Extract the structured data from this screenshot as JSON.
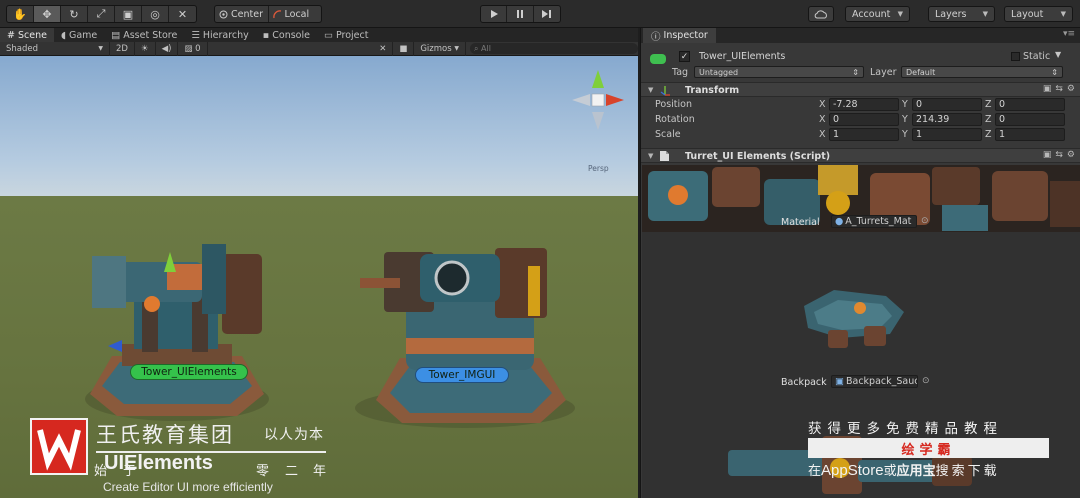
{
  "toolbar": {
    "transform_tools": [
      {
        "name": "hand-tool",
        "icon": "hand-icon",
        "glyph": "✋"
      },
      {
        "name": "move-tool",
        "icon": "move-arrows-icon",
        "glyph": "✥"
      },
      {
        "name": "rotate-tool",
        "icon": "rotate-icon",
        "glyph": "↻"
      },
      {
        "name": "scale-tool",
        "icon": "scale-icon",
        "glyph": "⤢"
      },
      {
        "name": "rect-tool",
        "icon": "rect-transform-icon",
        "glyph": "▣"
      },
      {
        "name": "transform-tool",
        "icon": "combined-transform-icon",
        "glyph": "◎"
      },
      {
        "name": "custom-tool",
        "icon": "wrench-icon",
        "glyph": "✕"
      }
    ],
    "pivot_mode": "Center",
    "pivot_rotation": "Local",
    "play_icons": [
      "play-icon",
      "pause-icon",
      "step-icon"
    ],
    "account_label": "Account",
    "layers_label": "Layers",
    "layout_label": "Layout"
  },
  "scene": {
    "tabs": [
      {
        "label": "Scene",
        "icon": "scene-icon",
        "active": true
      },
      {
        "label": "Game",
        "icon": "game-pacman-icon",
        "active": false
      },
      {
        "label": "Asset Store",
        "icon": "asset-store-icon",
        "active": false
      },
      {
        "label": "Hierarchy",
        "icon": "hierarchy-icon",
        "active": false
      },
      {
        "label": "Console",
        "icon": "console-icon",
        "active": false
      },
      {
        "label": "Project",
        "icon": "folder-icon",
        "active": false
      }
    ],
    "shading_mode": "Shaded",
    "mode_2d": "2D",
    "effects_count": "0",
    "gizmos_label": "Gizmos",
    "search_placeholder": "All",
    "projection_label": "Persp",
    "objects": [
      {
        "label": "Tower_UIElements",
        "color": "#35c24b"
      },
      {
        "label": "Tower_IMGUI",
        "color": "#3c8fe4"
      }
    ]
  },
  "inspector": {
    "tab_label": "Inspector",
    "object_name": "Tower_UIElements",
    "static_label": "Static",
    "tag_label": "Tag",
    "tag_value": "Untagged",
    "layer_label": "Layer",
    "layer_value": "Default",
    "transform": {
      "title": "Transform",
      "position": {
        "label": "Position",
        "x": "-7.28",
        "y": "0",
        "z": "0"
      },
      "rotation": {
        "label": "Rotation",
        "x": "0",
        "y": "214.39",
        "z": "0"
      },
      "scale": {
        "label": "Scale",
        "x": "1",
        "y": "1",
        "z": "1"
      }
    },
    "axis_labels": {
      "x": "X",
      "y": "Y",
      "z": "Z"
    },
    "script": {
      "title": "Turret_UI Elements (Script)",
      "material_label": "Material",
      "material_value": "A_Turrets_Mat",
      "backpack_label": "Backpack",
      "backpack_value": "Backpack_Sauc"
    }
  },
  "overlay": {
    "company_name": "王氏教育集团",
    "slogan": "以人为本",
    "partial_subtitle": [
      "始",
      "于",
      "零",
      "二",
      "年"
    ],
    "video_title": "UIElements",
    "video_subtitle": "Create Editor UI more efficiently",
    "promo_line1": "获得更多免费精品教程",
    "promo_banner": "绘学霸",
    "promo_line2_pre": "在",
    "promo_line2_store": "AppStore",
    "promo_line2_or": "或",
    "promo_line2_market": "应用宝",
    "promo_line2_post": "搜索下载",
    "logo_letter": "W"
  },
  "colors": {
    "brand_red": "#d6281f",
    "tower_ui_label": "#35c24b",
    "tower_imgui_label": "#3c8fe4",
    "promo_text": "#d6281f"
  }
}
